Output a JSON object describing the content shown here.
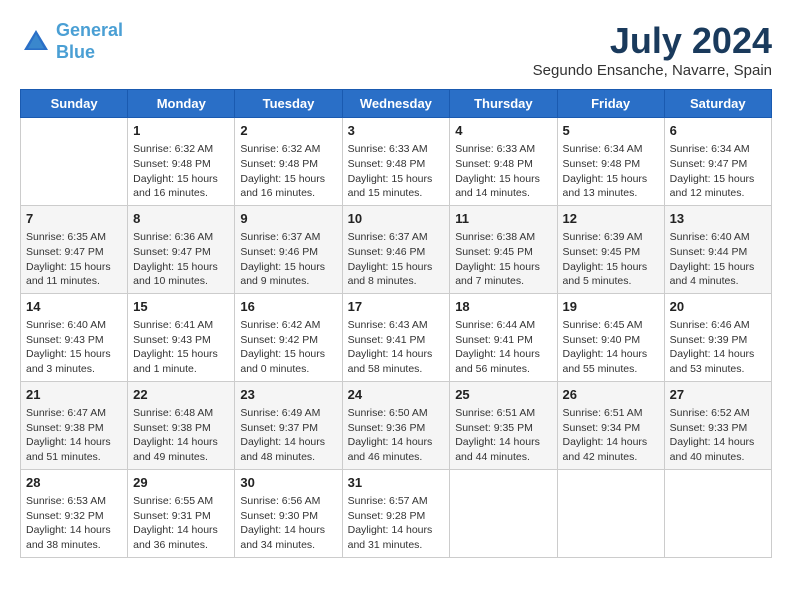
{
  "header": {
    "logo_line1": "General",
    "logo_line2": "Blue",
    "month_year": "July 2024",
    "location": "Segundo Ensanche, Navarre, Spain"
  },
  "weekdays": [
    "Sunday",
    "Monday",
    "Tuesday",
    "Wednesday",
    "Thursday",
    "Friday",
    "Saturday"
  ],
  "weeks": [
    [
      null,
      {
        "day": 1,
        "sunrise": "Sunrise: 6:32 AM",
        "sunset": "Sunset: 9:48 PM",
        "daylight": "Daylight: 15 hours and 16 minutes."
      },
      {
        "day": 2,
        "sunrise": "Sunrise: 6:32 AM",
        "sunset": "Sunset: 9:48 PM",
        "daylight": "Daylight: 15 hours and 16 minutes."
      },
      {
        "day": 3,
        "sunrise": "Sunrise: 6:33 AM",
        "sunset": "Sunset: 9:48 PM",
        "daylight": "Daylight: 15 hours and 15 minutes."
      },
      {
        "day": 4,
        "sunrise": "Sunrise: 6:33 AM",
        "sunset": "Sunset: 9:48 PM",
        "daylight": "Daylight: 15 hours and 14 minutes."
      },
      {
        "day": 5,
        "sunrise": "Sunrise: 6:34 AM",
        "sunset": "Sunset: 9:48 PM",
        "daylight": "Daylight: 15 hours and 13 minutes."
      },
      {
        "day": 6,
        "sunrise": "Sunrise: 6:34 AM",
        "sunset": "Sunset: 9:47 PM",
        "daylight": "Daylight: 15 hours and 12 minutes."
      }
    ],
    [
      {
        "day": 7,
        "sunrise": "Sunrise: 6:35 AM",
        "sunset": "Sunset: 9:47 PM",
        "daylight": "Daylight: 15 hours and 11 minutes."
      },
      {
        "day": 8,
        "sunrise": "Sunrise: 6:36 AM",
        "sunset": "Sunset: 9:47 PM",
        "daylight": "Daylight: 15 hours and 10 minutes."
      },
      {
        "day": 9,
        "sunrise": "Sunrise: 6:37 AM",
        "sunset": "Sunset: 9:46 PM",
        "daylight": "Daylight: 15 hours and 9 minutes."
      },
      {
        "day": 10,
        "sunrise": "Sunrise: 6:37 AM",
        "sunset": "Sunset: 9:46 PM",
        "daylight": "Daylight: 15 hours and 8 minutes."
      },
      {
        "day": 11,
        "sunrise": "Sunrise: 6:38 AM",
        "sunset": "Sunset: 9:45 PM",
        "daylight": "Daylight: 15 hours and 7 minutes."
      },
      {
        "day": 12,
        "sunrise": "Sunrise: 6:39 AM",
        "sunset": "Sunset: 9:45 PM",
        "daylight": "Daylight: 15 hours and 5 minutes."
      },
      {
        "day": 13,
        "sunrise": "Sunrise: 6:40 AM",
        "sunset": "Sunset: 9:44 PM",
        "daylight": "Daylight: 15 hours and 4 minutes."
      }
    ],
    [
      {
        "day": 14,
        "sunrise": "Sunrise: 6:40 AM",
        "sunset": "Sunset: 9:43 PM",
        "daylight": "Daylight: 15 hours and 3 minutes."
      },
      {
        "day": 15,
        "sunrise": "Sunrise: 6:41 AM",
        "sunset": "Sunset: 9:43 PM",
        "daylight": "Daylight: 15 hours and 1 minute."
      },
      {
        "day": 16,
        "sunrise": "Sunrise: 6:42 AM",
        "sunset": "Sunset: 9:42 PM",
        "daylight": "Daylight: 15 hours and 0 minutes."
      },
      {
        "day": 17,
        "sunrise": "Sunrise: 6:43 AM",
        "sunset": "Sunset: 9:41 PM",
        "daylight": "Daylight: 14 hours and 58 minutes."
      },
      {
        "day": 18,
        "sunrise": "Sunrise: 6:44 AM",
        "sunset": "Sunset: 9:41 PM",
        "daylight": "Daylight: 14 hours and 56 minutes."
      },
      {
        "day": 19,
        "sunrise": "Sunrise: 6:45 AM",
        "sunset": "Sunset: 9:40 PM",
        "daylight": "Daylight: 14 hours and 55 minutes."
      },
      {
        "day": 20,
        "sunrise": "Sunrise: 6:46 AM",
        "sunset": "Sunset: 9:39 PM",
        "daylight": "Daylight: 14 hours and 53 minutes."
      }
    ],
    [
      {
        "day": 21,
        "sunrise": "Sunrise: 6:47 AM",
        "sunset": "Sunset: 9:38 PM",
        "daylight": "Daylight: 14 hours and 51 minutes."
      },
      {
        "day": 22,
        "sunrise": "Sunrise: 6:48 AM",
        "sunset": "Sunset: 9:38 PM",
        "daylight": "Daylight: 14 hours and 49 minutes."
      },
      {
        "day": 23,
        "sunrise": "Sunrise: 6:49 AM",
        "sunset": "Sunset: 9:37 PM",
        "daylight": "Daylight: 14 hours and 48 minutes."
      },
      {
        "day": 24,
        "sunrise": "Sunrise: 6:50 AM",
        "sunset": "Sunset: 9:36 PM",
        "daylight": "Daylight: 14 hours and 46 minutes."
      },
      {
        "day": 25,
        "sunrise": "Sunrise: 6:51 AM",
        "sunset": "Sunset: 9:35 PM",
        "daylight": "Daylight: 14 hours and 44 minutes."
      },
      {
        "day": 26,
        "sunrise": "Sunrise: 6:51 AM",
        "sunset": "Sunset: 9:34 PM",
        "daylight": "Daylight: 14 hours and 42 minutes."
      },
      {
        "day": 27,
        "sunrise": "Sunrise: 6:52 AM",
        "sunset": "Sunset: 9:33 PM",
        "daylight": "Daylight: 14 hours and 40 minutes."
      }
    ],
    [
      {
        "day": 28,
        "sunrise": "Sunrise: 6:53 AM",
        "sunset": "Sunset: 9:32 PM",
        "daylight": "Daylight: 14 hours and 38 minutes."
      },
      {
        "day": 29,
        "sunrise": "Sunrise: 6:55 AM",
        "sunset": "Sunset: 9:31 PM",
        "daylight": "Daylight: 14 hours and 36 minutes."
      },
      {
        "day": 30,
        "sunrise": "Sunrise: 6:56 AM",
        "sunset": "Sunset: 9:30 PM",
        "daylight": "Daylight: 14 hours and 34 minutes."
      },
      {
        "day": 31,
        "sunrise": "Sunrise: 6:57 AM",
        "sunset": "Sunset: 9:28 PM",
        "daylight": "Daylight: 14 hours and 31 minutes."
      },
      null,
      null,
      null
    ]
  ]
}
